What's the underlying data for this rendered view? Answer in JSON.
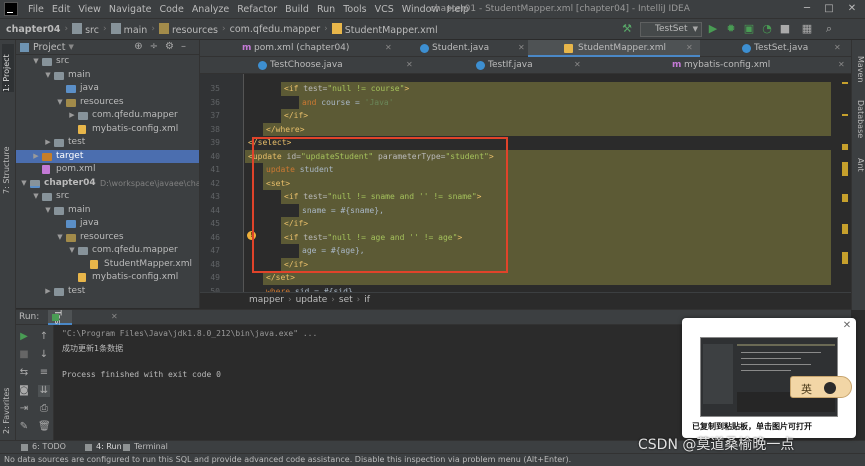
{
  "menubar": {
    "items": [
      "File",
      "Edit",
      "View",
      "Navigate",
      "Code",
      "Analyze",
      "Refactor",
      "Build",
      "Run",
      "Tools",
      "VCS",
      "Window",
      "Help"
    ],
    "window_title": "chapter01 - StudentMapper.xml [chapter04] - IntelliJ IDEA"
  },
  "navbar": {
    "crumbs": [
      "chapter04",
      "src",
      "main",
      "resources",
      "com.qfedu.mapper",
      "StudentMapper.xml"
    ],
    "run_config": "TestSet"
  },
  "left_stripe": {
    "project": "1: Project",
    "structure": "7: Structure",
    "favorites": "2: Favorites"
  },
  "right_stripe": {
    "maven": "Maven",
    "database": "Database",
    "ant": "Ant"
  },
  "project_panel": {
    "title": "Project",
    "rows": [
      {
        "label": "src",
        "depth": 2,
        "icon": "folder",
        "arrow": "▼"
      },
      {
        "label": "main",
        "depth": 3,
        "icon": "folder",
        "arrow": "▼"
      },
      {
        "label": "java",
        "depth": 4,
        "icon": "src",
        "arrow": ""
      },
      {
        "label": "resources",
        "depth": 4,
        "icon": "res",
        "arrow": "▼"
      },
      {
        "label": "com.qfedu.mapper",
        "depth": 5,
        "icon": "pkg",
        "arrow": "▶"
      },
      {
        "label": "mybatis-config.xml",
        "depth": 5,
        "icon": "xml",
        "arrow": ""
      },
      {
        "label": "test",
        "depth": 3,
        "icon": "folder",
        "arrow": "▶"
      },
      {
        "label": "target",
        "depth": 2,
        "icon": "target",
        "arrow": "▶",
        "sel": true
      },
      {
        "label": "pom.xml",
        "depth": 2,
        "icon": "pom",
        "arrow": ""
      },
      {
        "label": "chapter04",
        "depth": 1,
        "icon": "mod",
        "arrow": "▼",
        "bold": true,
        "path": "D:\\workspace\\javaee\\chapter0"
      },
      {
        "label": "src",
        "depth": 2,
        "icon": "folder",
        "arrow": "▼"
      },
      {
        "label": "main",
        "depth": 3,
        "icon": "folder",
        "arrow": "▼"
      },
      {
        "label": "java",
        "depth": 4,
        "icon": "src",
        "arrow": ""
      },
      {
        "label": "resources",
        "depth": 4,
        "icon": "res",
        "arrow": "▼"
      },
      {
        "label": "com.qfedu.mapper",
        "depth": 5,
        "icon": "pkg",
        "arrow": "▼"
      },
      {
        "label": "StudentMapper.xml",
        "depth": 6,
        "icon": "xml",
        "arrow": ""
      },
      {
        "label": "mybatis-config.xml",
        "depth": 5,
        "icon": "xml",
        "arrow": ""
      },
      {
        "label": "test",
        "depth": 3,
        "icon": "folder",
        "arrow": "▶"
      }
    ]
  },
  "tabs_row1": [
    {
      "label": "pom.xml (chapter04)",
      "icon": "m",
      "active": false
    },
    {
      "label": "Student.java",
      "icon": "c",
      "active": false
    },
    {
      "label": "StudentMapper.xml",
      "icon": "x",
      "active": true
    },
    {
      "label": "TestSet.java",
      "icon": "c",
      "active": false
    }
  ],
  "tabs_row2": [
    {
      "label": "TestChoose.java",
      "icon": "c",
      "active": false
    },
    {
      "label": "TestIf.java",
      "icon": "c",
      "active": false
    },
    {
      "label": "mybatis-config.xml",
      "icon": "m",
      "active": false
    }
  ],
  "editor": {
    "lines": [
      {
        "n": "35",
        "hl": true,
        "ind": 3,
        "parts": [
          [
            "tg",
            "<if "
          ],
          [
            "at",
            "test="
          ],
          [
            "av",
            "\"null != course\""
          ],
          [
            "tg",
            ">"
          ]
        ]
      },
      {
        "n": "36",
        "hl": true,
        "ind": 4,
        "parts": [
          [
            "kw",
            "and"
          ],
          [
            "tx",
            " course = "
          ],
          [
            "st",
            "'Java'"
          ]
        ]
      },
      {
        "n": "37",
        "hl": true,
        "ind": 3,
        "parts": [
          [
            "tg",
            "</if>"
          ]
        ]
      },
      {
        "n": "38",
        "hl": true,
        "ind": 2,
        "parts": [
          [
            "tg",
            "</where>"
          ]
        ]
      },
      {
        "n": "39",
        "hl": false,
        "ind": 1,
        "parts": [
          [
            "tg",
            "</select>"
          ]
        ]
      },
      {
        "n": "40",
        "hl": true,
        "ind": 1,
        "parts": [
          [
            "tg",
            "<update "
          ],
          [
            "at",
            "id="
          ],
          [
            "av",
            "\"updateStudent\""
          ],
          [
            "at",
            " parameterType="
          ],
          [
            "av",
            "\"student\""
          ],
          [
            "tg",
            ">"
          ]
        ]
      },
      {
        "n": "41",
        "hl": true,
        "ind": 2,
        "parts": [
          [
            "kw",
            "update"
          ],
          [
            "tx",
            " student"
          ]
        ]
      },
      {
        "n": "42",
        "hl": true,
        "ind": 2,
        "parts": [
          [
            "tg",
            "<set>"
          ]
        ]
      },
      {
        "n": "43",
        "hl": true,
        "ind": 3,
        "parts": [
          [
            "tg",
            "<if "
          ],
          [
            "at",
            "test="
          ],
          [
            "av",
            "\"null != sname and '' != sname\""
          ],
          [
            "tg",
            ">"
          ]
        ]
      },
      {
        "n": "44",
        "hl": true,
        "ind": 4,
        "parts": [
          [
            "tx",
            "sname = #{sname},"
          ]
        ]
      },
      {
        "n": "45",
        "hl": true,
        "ind": 3,
        "parts": [
          [
            "tg",
            "</if>"
          ]
        ]
      },
      {
        "n": "46",
        "hl": true,
        "ind": 3,
        "parts": [
          [
            "tg",
            "<if "
          ],
          [
            "at",
            "test="
          ],
          [
            "av",
            "\"null != age and '' != age\""
          ],
          [
            "tg",
            ">"
          ]
        ]
      },
      {
        "n": "47",
        "hl": true,
        "ind": 4,
        "parts": [
          [
            "tx",
            "age = #{age},"
          ]
        ]
      },
      {
        "n": "48",
        "hl": true,
        "ind": 3,
        "parts": [
          [
            "tg",
            "</if>"
          ]
        ]
      },
      {
        "n": "49",
        "hl": true,
        "ind": 2,
        "parts": [
          [
            "tg",
            "</set>"
          ]
        ]
      },
      {
        "n": "50",
        "hl": false,
        "ind": 2,
        "parts": [
          [
            "kw",
            "where"
          ],
          [
            "tx",
            " sid = #{sid}"
          ]
        ]
      }
    ]
  },
  "breadcrumb": [
    "mapper",
    "update",
    "set",
    "if"
  ],
  "run_panel": {
    "label": "Run:",
    "tab": "TestSet",
    "lines": [
      "\"C:\\Program Files\\Java\\jdk1.8.0_212\\bin\\java.exe\" ...",
      "成功更新1条数据",
      "",
      "Process finished with exit code 0"
    ]
  },
  "bottom_tabs": [
    "6: TODO",
    "4: Run",
    "Terminal"
  ],
  "statusbar": "No data sources are configured to run this SQL and provide advanced code assistance. Disable this inspection via problem menu (Alt+Enter).",
  "popup": {
    "message": "已复制到粘贴板，单击图片可打开",
    "ime_label": "英"
  },
  "watermark": "CSDN @莫道桑榆晚一点"
}
